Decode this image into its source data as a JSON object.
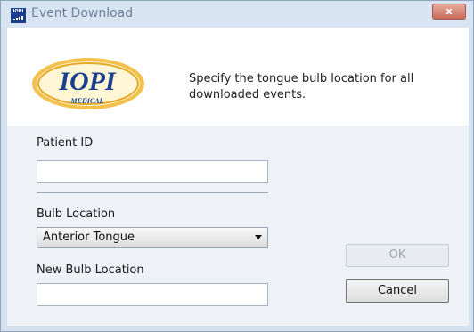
{
  "window": {
    "title": "Event Download",
    "app_icon_text": "IOPI",
    "close_label": "x"
  },
  "header": {
    "logo_text": "IOPI",
    "logo_subtext": "MEDICAL",
    "instruction": "Specify the tongue bulb location for all downloaded events."
  },
  "form": {
    "patient_id_label": "Patient ID",
    "patient_id_value": "",
    "bulb_location_label": "Bulb Location",
    "bulb_location_selected": "Anterior Tongue",
    "new_bulb_location_label": "New Bulb Location",
    "new_bulb_location_value": ""
  },
  "buttons": {
    "ok": "OK",
    "cancel": "Cancel"
  },
  "colors": {
    "brand_blue": "#1b3f8f",
    "logo_gold": "#f2c14e",
    "close_red": "#c96b5c"
  }
}
